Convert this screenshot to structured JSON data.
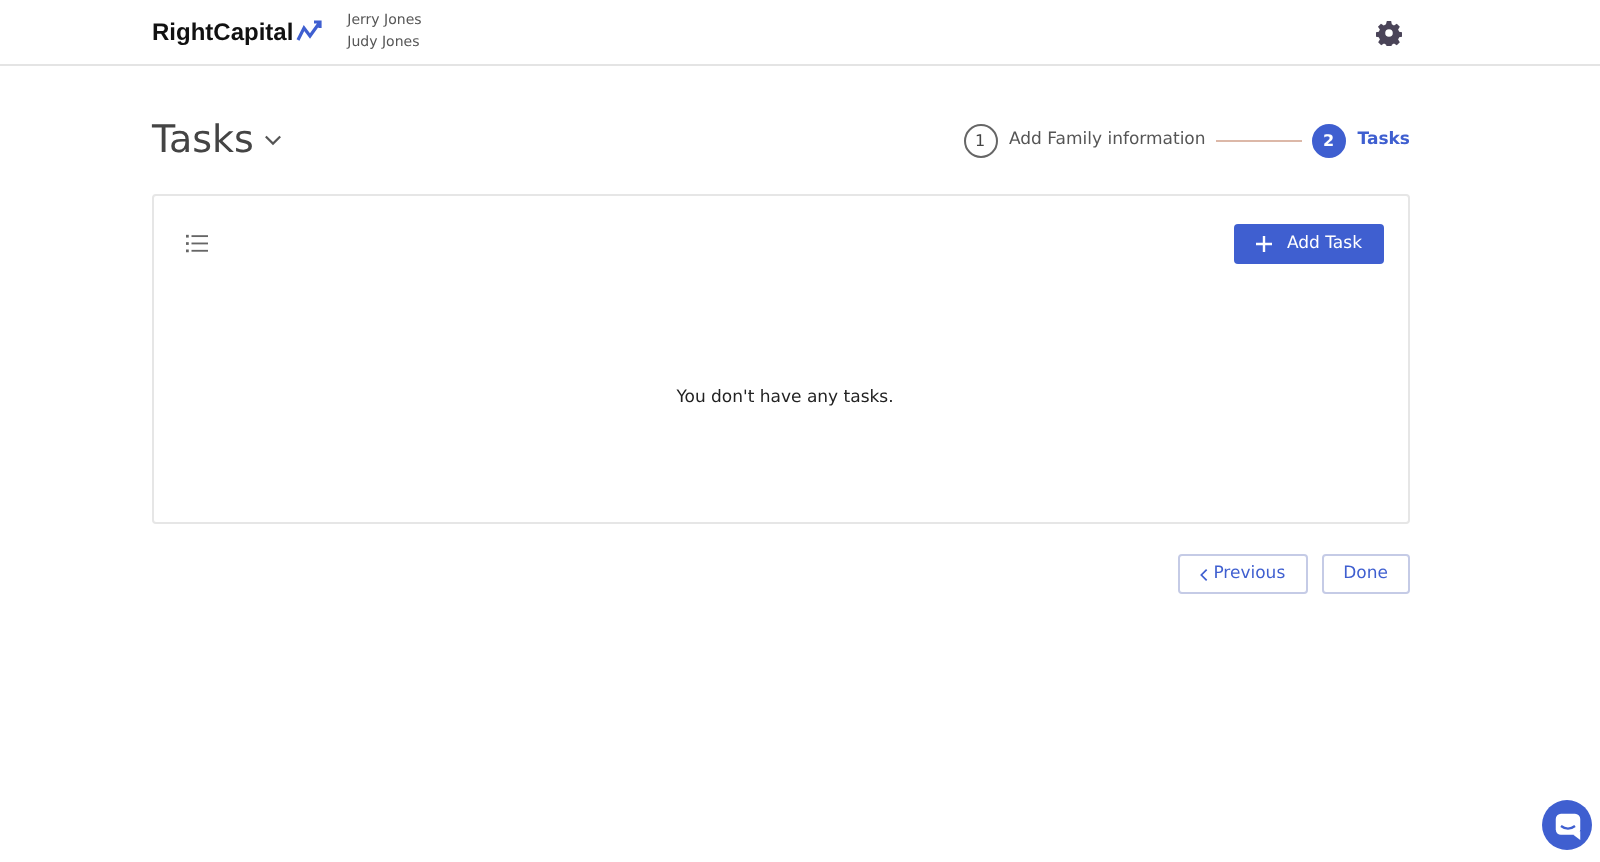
{
  "header": {
    "logo": "RightCapital",
    "clients": [
      "Jerry Jones",
      "Judy Jones"
    ]
  },
  "page": {
    "title": "Tasks"
  },
  "steps": [
    {
      "number": "1",
      "label": "Add Family information",
      "selected": false
    },
    {
      "number": "2",
      "label": "Tasks",
      "selected": true
    }
  ],
  "card": {
    "add_button": "Add Task",
    "empty_message": "You don't have any tasks."
  },
  "buttons": {
    "previous": "Previous",
    "done": "Done"
  }
}
